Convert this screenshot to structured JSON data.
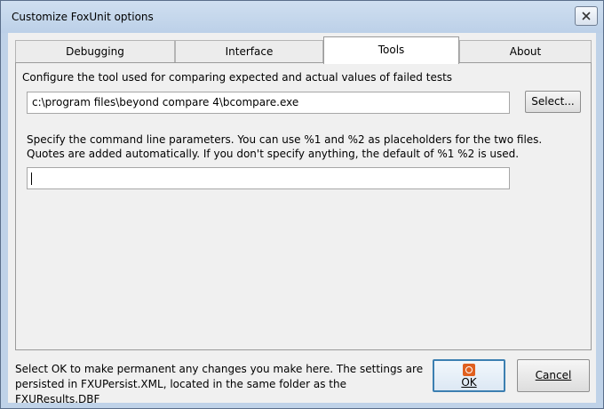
{
  "window": {
    "title": "Customize FoxUnit options"
  },
  "tabs": [
    {
      "label": "Debugging"
    },
    {
      "label": "Interface"
    },
    {
      "label": "Tools"
    },
    {
      "label": "About"
    }
  ],
  "tools_page": {
    "compare_description": "Configure the tool used for comparing expected and actual values of failed tests",
    "tool_path_value": "c:\\program files\\beyond compare 4\\bcompare.exe",
    "select_button_label": "Select...",
    "params_description": "Specify the command line parameters. You can use %1 and %2 as placeholders for the two files. Quotes are added automatically. If you don't specify anything, the default of %1 %2 is used.",
    "params_value": ""
  },
  "footer": {
    "info_text": "Select OK to make permanent any changes you make here.  The settings are persisted in FXUPersist.XML, located in the same folder as the FXUResults.DBF",
    "ok_label": "OK",
    "cancel_label": "Cancel"
  }
}
